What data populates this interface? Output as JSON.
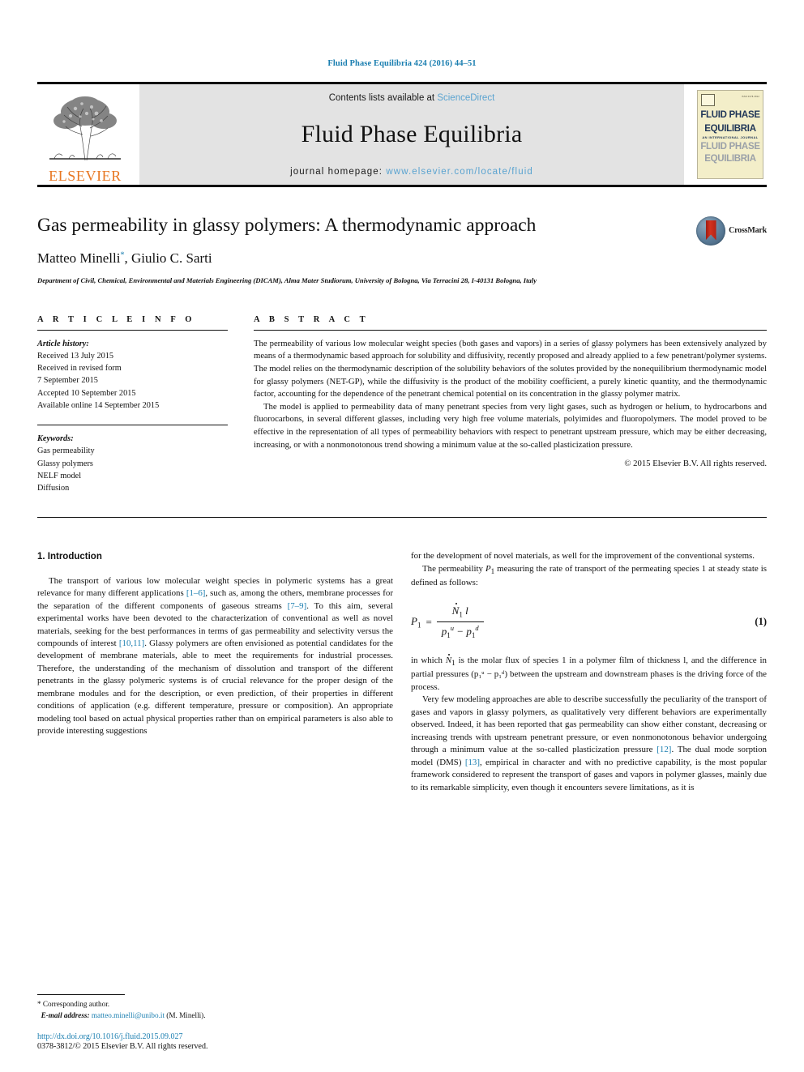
{
  "running_head": "Fluid Phase Equilibria 424 (2016) 44–51",
  "masthead": {
    "contents_prefix": "Contents lists available at ",
    "sciencedirect": "ScienceDirect",
    "journal_title": "Fluid Phase Equilibria",
    "homepage_label": "journal homepage: ",
    "homepage_url": "www.elsevier.com/locate/fluid",
    "publisher_wordmark": "ELSEVIER",
    "cover": {
      "issn_corner": "ISSN 0378-3812",
      "title_line1": "FLUID PHASE",
      "title_line2": "EQUILIBRIA",
      "subtitle": "AN INTERNATIONAL JOURNAL",
      "ghost_line1": "FLUID PHASE",
      "ghost_line2": "EQUILIBRIA"
    },
    "accent_blue": "#5aa3d0",
    "band_grey": "#e3e3e3"
  },
  "article": {
    "title": "Gas permeability in glassy polymers: A thermodynamic approach",
    "authors_pre": "Matteo Minelli",
    "author_marker": "*",
    "authors_post": ", Giulio C. Sarti",
    "affiliation": "Department of Civil, Chemical, Environmental and Materials Engineering (DICAM), Alma Mater Studiorum, University of Bologna, Via Terracini 28, I-40131 Bologna, Italy",
    "crossmark_label": "CrossMark"
  },
  "article_info": {
    "heading": "A R T I C L E   I N F O",
    "history_label": "Article history:",
    "history": [
      "Received 13 July 2015",
      "Received in revised form",
      "7 September 2015",
      "Accepted 10 September 2015",
      "Available online 14 September 2015"
    ],
    "keywords_label": "Keywords:",
    "keywords": [
      "Gas permeability",
      "Glassy polymers",
      "NELF model",
      "Diffusion"
    ]
  },
  "abstract": {
    "heading": "A B S T R A C T",
    "paragraph1": "The permeability of various low molecular weight species (both gases and vapors) in a series of glassy polymers has been extensively analyzed by means of a thermodynamic based approach for solubility and diffusivity, recently proposed and already applied to a few penetrant/polymer systems. The model relies on the thermodynamic description of the solubility behaviors of the solutes provided by the nonequilibrium thermodynamic model for glassy polymers (NET-GP), while the diffusivity is the product of the mobility coefficient, a purely kinetic quantity, and the thermodynamic factor, accounting for the dependence of the penetrant chemical potential on its concentration in the glassy polymer matrix.",
    "paragraph2": "The model is applied to permeability data of many penetrant species from very light gases, such as hydrogen or helium, to hydrocarbons and fluorocarbons, in several different glasses, including very high free volume materials, polyimides and fluoropolymers. The model proved to be effective in the representation of all types of permeability behaviors with respect to penetrant upstream pressure, which may be either decreasing, increasing, or with a nonmonotonous trend showing a minimum value at the so-called plasticization pressure.",
    "copyright": "© 2015 Elsevier B.V. All rights reserved."
  },
  "body": {
    "section_number_title": "1. Introduction",
    "left_p1_a": "The transport of various low molecular weight species in polymeric systems has a great relevance for many different applications ",
    "left_ref1": "[1–6]",
    "left_p1_b": ", such as, among the others, membrane processes for the separation of the different components of gaseous streams ",
    "left_ref2": "[7–9]",
    "left_p1_c": ". To this aim, several experimental works have been devoted to the characterization of conventional as well as novel materials, seeking for the best performances in terms of gas permeability and selectivity versus the compounds of interest ",
    "left_ref3": "[10,11]",
    "left_p1_d": ". Glassy polymers are often envisioned as potential candidates for the development of membrane materials, able to meet the requirements for industrial processes. Therefore, the understanding of the mechanism of dissolution and transport of the different penetrants in the glassy polymeric systems is of crucial relevance for the proper design of the membrane modules and for the description, or even prediction, of their properties in different conditions of application (e.g. different temperature, pressure or composition). An appropriate modeling tool based on actual physical properties rather than on empirical parameters is also able to provide interesting suggestions",
    "right_p1": "for the development of novel materials, as well for the improvement of the conventional systems.",
    "right_p2_a": "The permeability ",
    "right_p2_sym": "P",
    "right_p2_sub": "1",
    "right_p2_b": " measuring the rate of transport of the permeating species 1 at steady state is defined as follows:",
    "equation": {
      "lhs": "P",
      "lhs_sub": "1",
      "equals": "=",
      "numerator": "N₁ l",
      "num_sym": "N",
      "num_sub": "1",
      "num_var": "l",
      "den_sym1": "p",
      "den_sub1": "1",
      "den_sup1": "u",
      "den_minus": "−",
      "den_sym2": "p",
      "den_sub2": "1",
      "den_sup2": "d",
      "number": "(1)"
    },
    "right_p3_a": "in which ",
    "right_p3_sym": "N",
    "right_p3_sub": "1",
    "right_p3_b": " is the molar flux of species 1 in a polymer film of thickness l, and the difference in partial pressures (p₁ᵘ − p₁ᵈ) between the upstream and downstream phases is the driving force of the process.",
    "right_p4_a": "Very few modeling approaches are able to describe successfully the peculiarity of the transport of gases and vapors in glassy polymers, as qualitatively very different behaviors are experimentally observed. Indeed, it has been reported that gas permeability can show either constant, decreasing or increasing trends with upstream penetrant pressure, or even nonmonotonous behavior undergoing through a minimum value at the so-called plasticization pressure ",
    "right_ref12": "[12]",
    "right_p4_b": ". The dual mode sorption model (DMS) ",
    "right_ref13": "[13]",
    "right_p4_c": ", empirical in character and with no predictive capability, is the most popular framework considered to represent the transport of gases and vapors in polymer glasses, mainly due to its remarkable simplicity, even though it encounters severe limitations, as it is"
  },
  "footer": {
    "corresponding_marker": "*",
    "corresponding_label": " Corresponding author.",
    "email_label": "E-mail address:",
    "email": "matteo.minelli@unibo.it",
    "email_suffix": " (M. Minelli).",
    "doi_url": "http://dx.doi.org/10.1016/j.fluid.2015.09.027",
    "issn_line": "0378-3812/© 2015 Elsevier B.V. All rights reserved."
  }
}
